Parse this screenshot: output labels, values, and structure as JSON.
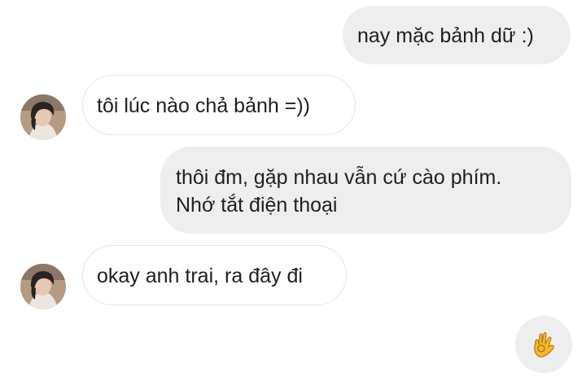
{
  "messages": [
    {
      "from": "me",
      "lines": [
        "nay mặc bảnh dữ :)"
      ]
    },
    {
      "from": "other",
      "lines": [
        "tôi lúc nào chả bảnh =))"
      ]
    },
    {
      "from": "me",
      "lines": [
        "thôi đm, gặp nhau vẫn cứ cào phím.",
        "Nhớ tắt điện thoại"
      ]
    },
    {
      "from": "other",
      "lines": [
        "okay anh trai, ra đây đi"
      ]
    }
  ],
  "reaction": {
    "icon": "ok-hand-icon"
  },
  "colors": {
    "sent_bubble": "#eeeeee",
    "received_bubble_border": "#e6e6e6",
    "text": "#1f1f1f",
    "emoji": "#f5b82e"
  }
}
